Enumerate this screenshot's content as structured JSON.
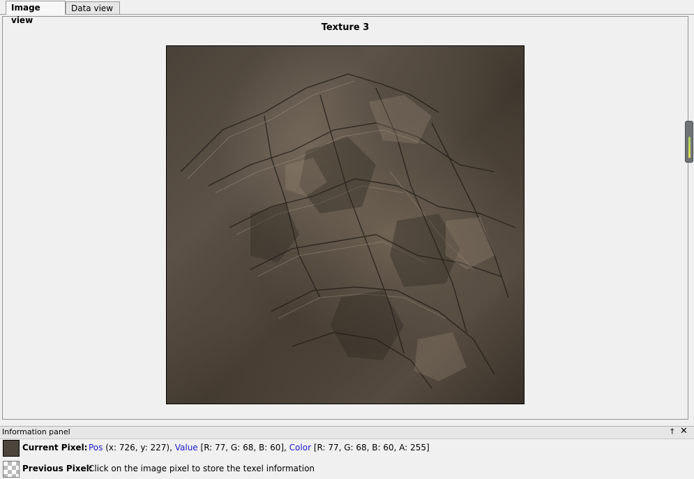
{
  "tabs": [
    {
      "label": "Image view",
      "active": true
    },
    {
      "label": "Data view",
      "active": false
    }
  ],
  "view": {
    "title": "Texture 3"
  },
  "info_panel": {
    "title": "Information panel",
    "pin_icon": "†",
    "close_icon": "✕",
    "current_pixel": {
      "label": "Current Pixel:",
      "swatch_color": "#4d443c",
      "pos_label": "Pos",
      "pos_value": "(x: 726, y: 227),",
      "value_label": "Value",
      "value_value": "[R: 77, G: 68, B: 60],",
      "color_label": "Color",
      "color_value": "[R: 77, G: 68, B: 60, A: 255]"
    },
    "previous_pixel": {
      "label": "Previous Pixel:",
      "message": "Click on the image pixel to store the texel information"
    }
  },
  "colors": {
    "link": "#1a1acc",
    "panel_bg": "#f0f0f0"
  }
}
